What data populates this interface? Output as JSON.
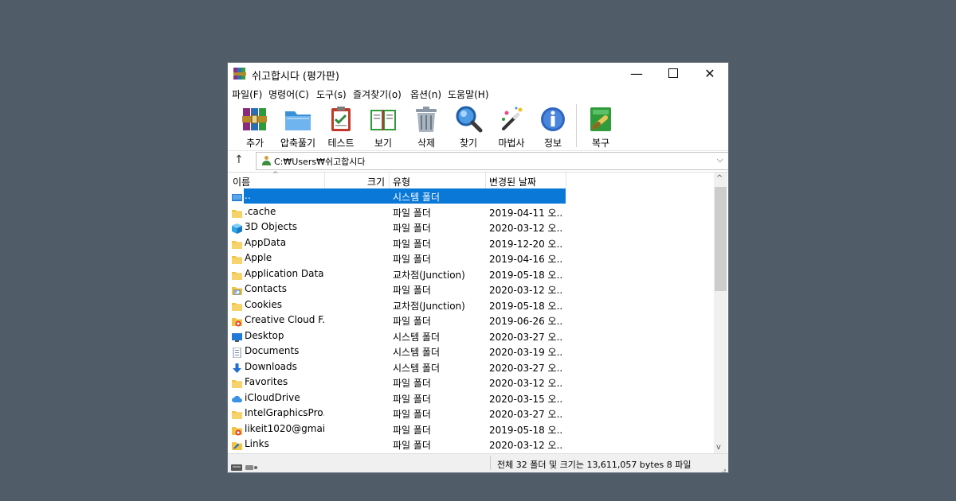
{
  "window": {
    "title": "쉬고합시다 (평가판)",
    "minimize_glyph": "—",
    "close_glyph": "✕"
  },
  "menu": [
    {
      "label": "파일(F)"
    },
    {
      "label": "명령어(C)"
    },
    {
      "label": "도구(s)"
    },
    {
      "label": "즐겨찾기(o)"
    },
    {
      "label": "옵션(n)"
    },
    {
      "label": "도움말(H)"
    }
  ],
  "toolbar": [
    {
      "label": "추가",
      "icon": "add-archive-icon"
    },
    {
      "label": "압축풀기",
      "icon": "extract-folder-icon"
    },
    {
      "label": "테스트",
      "icon": "test-clipboard-icon"
    },
    {
      "label": "보기",
      "icon": "view-book-icon"
    },
    {
      "label": "삭제",
      "icon": "delete-trash-icon"
    },
    {
      "label": "찾기",
      "icon": "find-magnifier-icon"
    },
    {
      "label": "마법사",
      "icon": "wizard-wand-icon"
    },
    {
      "label": "정보",
      "icon": "info-icon"
    },
    {
      "label": "복구",
      "icon": "repair-icon"
    }
  ],
  "address": {
    "up_glyph": "↑",
    "path": "C:₩Users₩쉬고합시다",
    "dropdown_glyph": "⌵"
  },
  "columns": {
    "name": "이름",
    "size": "크기",
    "type": "유형",
    "modified": "변경된 날짜",
    "sort_glyph": "^"
  },
  "files": [
    {
      "name": "..",
      "type": "시스템 폴더",
      "date": "",
      "icon": "drive-icon",
      "selected": true
    },
    {
      "name": ".cache",
      "type": "파일 폴더",
      "date": "2019-04-11 오...",
      "icon": "folder-icon"
    },
    {
      "name": "3D Objects",
      "type": "파일 폴더",
      "date": "2020-03-12 오...",
      "icon": "cube-3d-icon"
    },
    {
      "name": "AppData",
      "type": "파일 폴더",
      "date": "2019-12-20 오...",
      "icon": "folder-icon"
    },
    {
      "name": "Apple",
      "type": "파일 폴더",
      "date": "2019-04-16 오...",
      "icon": "folder-icon"
    },
    {
      "name": "Application Data",
      "type": "교차점(Junction)",
      "date": "2019-05-18 오...",
      "icon": "folder-icon"
    },
    {
      "name": "Contacts",
      "type": "파일 폴더",
      "date": "2020-03-12 오...",
      "icon": "contacts-icon"
    },
    {
      "name": "Cookies",
      "type": "교차점(Junction)",
      "date": "2019-05-18 오...",
      "icon": "folder-icon"
    },
    {
      "name": "Creative Cloud F...",
      "type": "파일 폴더",
      "date": "2019-06-26 오...",
      "icon": "creative-cloud-icon"
    },
    {
      "name": "Desktop",
      "type": "시스템 폴더",
      "date": "2020-03-27 오...",
      "icon": "desktop-icon"
    },
    {
      "name": "Documents",
      "type": "시스템 폴더",
      "date": "2020-03-19 오...",
      "icon": "document-icon"
    },
    {
      "name": "Downloads",
      "type": "시스템 폴더",
      "date": "2020-03-27 오...",
      "icon": "download-arrow-icon"
    },
    {
      "name": "Favorites",
      "type": "파일 폴더",
      "date": "2020-03-12 오...",
      "icon": "folder-icon"
    },
    {
      "name": "iCloudDrive",
      "type": "파일 폴더",
      "date": "2020-03-15 오...",
      "icon": "icloud-icon"
    },
    {
      "name": "IntelGraphicsPro...",
      "type": "파일 폴더",
      "date": "2020-03-27 오...",
      "icon": "folder-icon"
    },
    {
      "name": "likeit1020@gmai...",
      "type": "파일 폴더",
      "date": "2019-05-18 오...",
      "icon": "creative-cloud-icon"
    },
    {
      "name": "Links",
      "type": "파일 폴더",
      "date": "2020-03-12 오...",
      "icon": "links-folder-icon"
    }
  ],
  "status": {
    "summary": "전체 32 폴더 및 크기는 13,611,057 bytes 8 파일"
  },
  "colors": {
    "selection": "#0a78d7",
    "folder": "#f3c443",
    "background": "#515c69"
  }
}
